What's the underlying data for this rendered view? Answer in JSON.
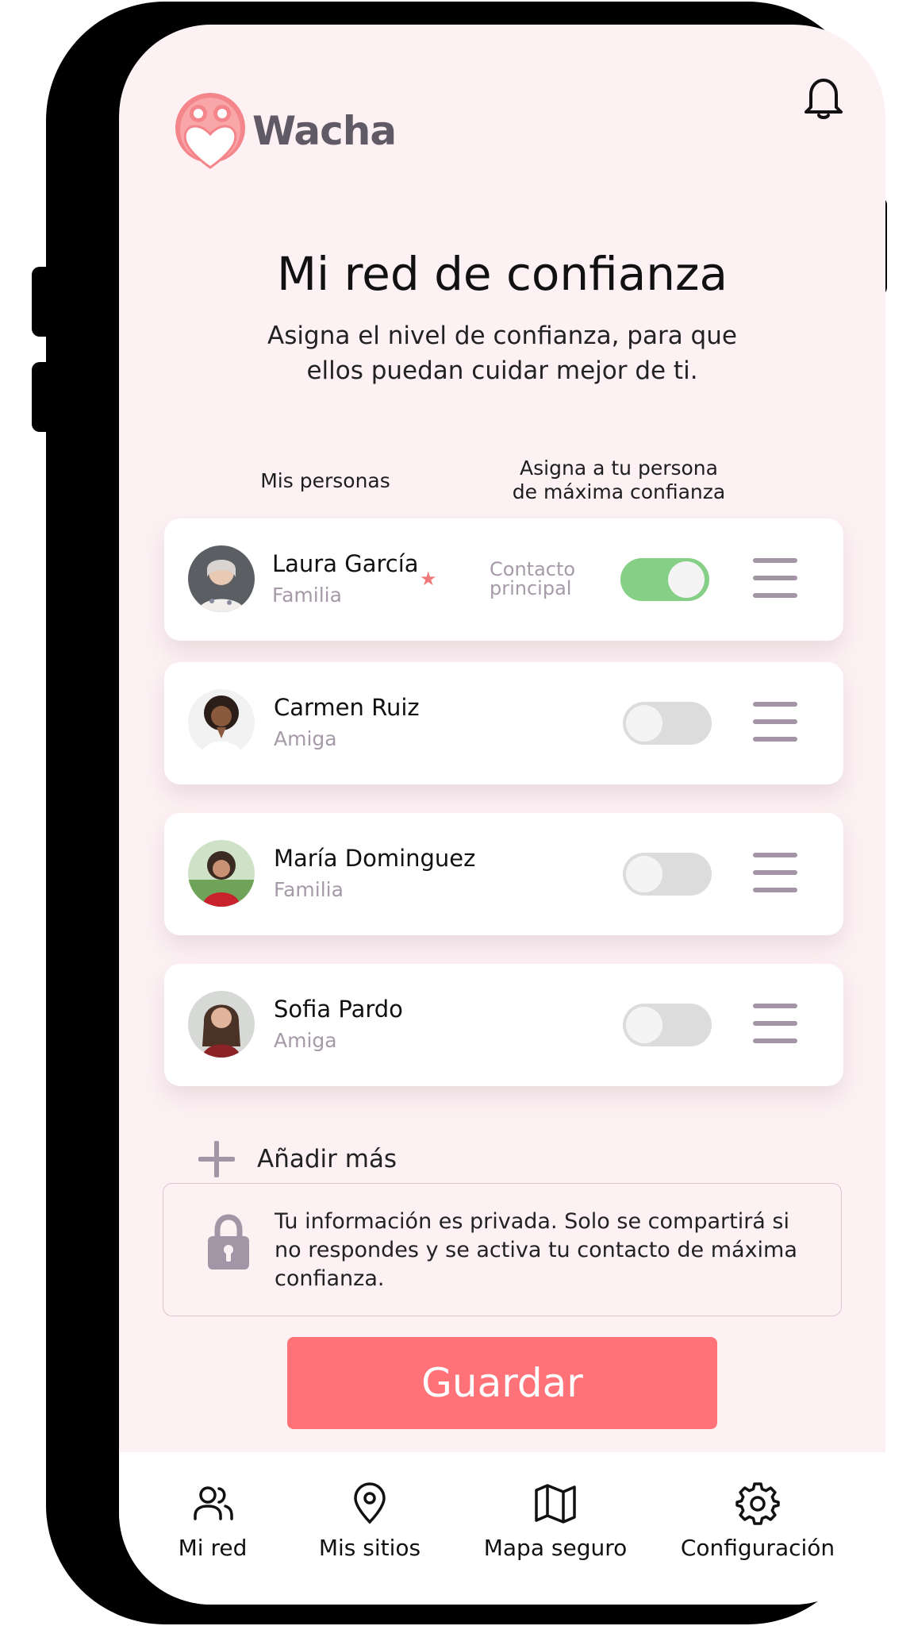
{
  "app": {
    "name": "Wacha"
  },
  "page": {
    "title": "Mi red de confianza",
    "subtitle": "Asigna el nivel de confianza, para que ellos puedan cuidar mejor de ti."
  },
  "columns": {
    "people": "Mis personas",
    "assign_line1": "Asigna a tu persona",
    "assign_line2": "de máxima confianza"
  },
  "contacts": [
    {
      "name": "Laura García",
      "relation": "Familia",
      "starred": true,
      "principal_label_line1": "Contacto",
      "principal_label_line2": "principal",
      "max_trust": true
    },
    {
      "name": "Carmen Ruiz",
      "relation": "Amiga",
      "max_trust": false
    },
    {
      "name": "María Dominguez",
      "relation": "Familia",
      "max_trust": false
    },
    {
      "name": "Sofia Pardo",
      "relation": "Amiga",
      "max_trust": false
    }
  ],
  "add_more": "Añadir más",
  "privacy_note": "Tu información es privada. Solo se compartirá si no respondes y se activa tu contacto de máxima confianza.",
  "save_label": "Guardar",
  "nav": [
    {
      "label": "Mi red",
      "icon": "users-icon"
    },
    {
      "label": "Mis sitios",
      "icon": "location-pin-icon"
    },
    {
      "label": "Mapa seguro",
      "icon": "map-icon"
    },
    {
      "label": "Configuración",
      "icon": "gear-icon"
    }
  ],
  "colors": {
    "accent": "#ff7378",
    "toggle_on": "#86cf86",
    "muted": "#a69aa9",
    "background": "#fdf1f4"
  }
}
